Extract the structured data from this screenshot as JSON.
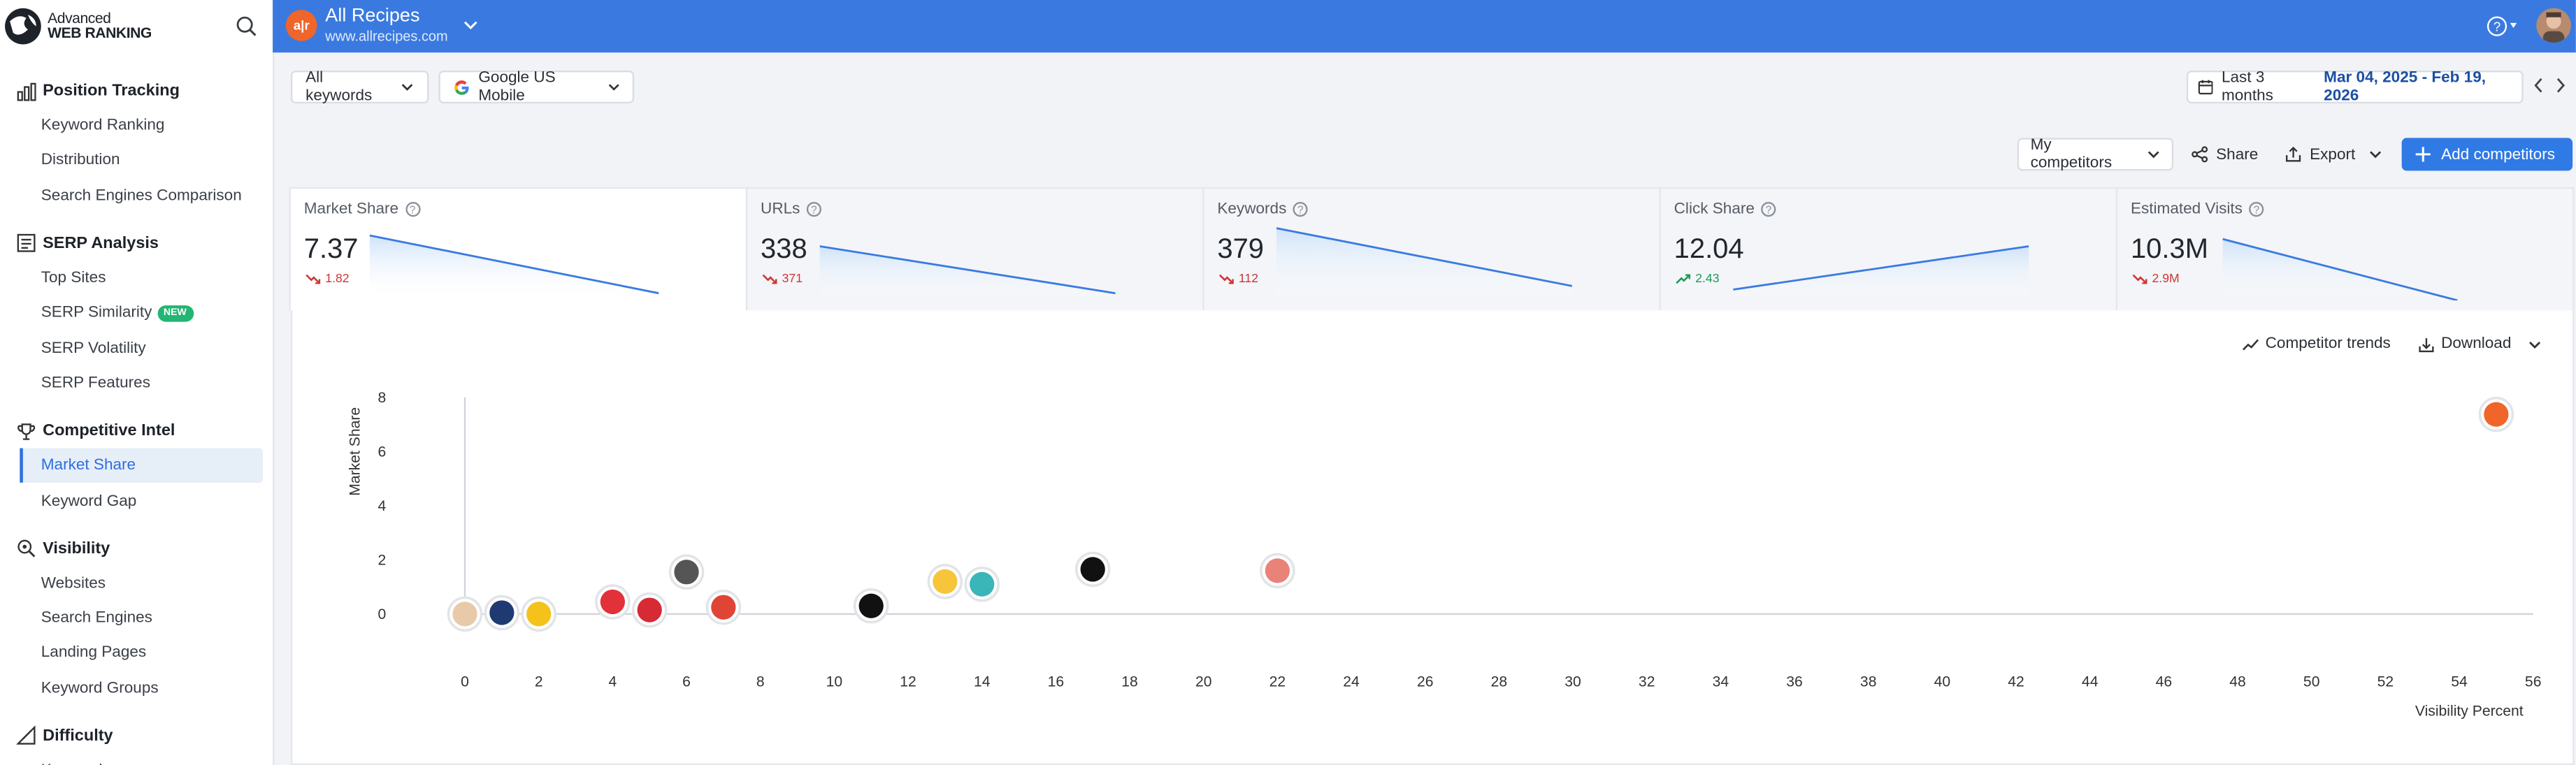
{
  "app": {
    "logo_line1": "Advanced",
    "logo_line2": "WEB RANKING"
  },
  "sidebar": {
    "sections": [
      {
        "label": "Position Tracking",
        "icon": "bar-chart-icon",
        "items": [
          {
            "label": "Keyword Ranking"
          },
          {
            "label": "Distribution"
          },
          {
            "label": "Search Engines Comparison"
          }
        ]
      },
      {
        "label": "SERP Analysis",
        "icon": "serp-icon",
        "items": [
          {
            "label": "Top Sites"
          },
          {
            "label": "SERP Similarity",
            "badge": "NEW"
          },
          {
            "label": "SERP Volatility"
          },
          {
            "label": "SERP Features"
          }
        ]
      },
      {
        "label": "Competitive Intel",
        "icon": "trophy-icon",
        "items": [
          {
            "label": "Market Share",
            "active": true
          },
          {
            "label": "Keyword Gap"
          }
        ]
      },
      {
        "label": "Visibility",
        "icon": "visibility-search-icon",
        "items": [
          {
            "label": "Websites"
          },
          {
            "label": "Search Engines"
          },
          {
            "label": "Landing Pages"
          },
          {
            "label": "Keyword Groups"
          }
        ]
      },
      {
        "label": "Difficulty",
        "icon": "difficulty-icon",
        "items": [
          {
            "label": "Keywords"
          }
        ]
      }
    ]
  },
  "header": {
    "project_name": "All Recipes",
    "project_url": "www.allrecipes.com",
    "project_logo_text": "a|r",
    "help_label": "?"
  },
  "filters": {
    "keywords": "All keywords",
    "engine": "Google US Mobile",
    "period_label": "Last 3 months",
    "date_range": "Mar 04, 2025 - Feb 19, 2026"
  },
  "toolbar": {
    "competitors": "My competitors",
    "share": "Share",
    "export": "Export",
    "add_competitors": "Add competitors"
  },
  "metrics": [
    {
      "label": "Market Share",
      "value": "7.37",
      "delta": "1.82",
      "trend": "down",
      "spark": [
        0.9,
        0.1
      ]
    },
    {
      "label": "URLs",
      "value": "338",
      "delta": "371",
      "trend": "down",
      "spark": [
        0.75,
        0.1
      ]
    },
    {
      "label": "Keywords",
      "value": "379",
      "delta": "112",
      "trend": "down",
      "spark": [
        1.0,
        0.2
      ]
    },
    {
      "label": "Click Share",
      "value": "12.04",
      "delta": "2.43",
      "trend": "up",
      "spark": [
        0.15,
        0.75
      ]
    },
    {
      "label": "Estimated Visits",
      "value": "10.3M",
      "delta": "2.9M",
      "trend": "down",
      "spark": [
        0.85,
        0.0
      ]
    }
  ],
  "chart_actions": {
    "trends": "Competitor trends",
    "download": "Download"
  },
  "chart_data": {
    "type": "scatter",
    "ylabel": "Market Share",
    "xlabel": "Visibility Percent",
    "ylim": [
      0,
      8
    ],
    "y_ticks": [
      "0",
      "2",
      "4",
      "6",
      "8"
    ],
    "x_ticks": [
      "0",
      "2",
      "4",
      "6",
      "8",
      "10",
      "12",
      "14",
      "16",
      "18",
      "20",
      "22",
      "24",
      "26",
      "28",
      "30",
      "32",
      "34",
      "36",
      "38",
      "40",
      "42",
      "44",
      "46",
      "48",
      "50",
      "52",
      "54",
      "56"
    ],
    "grid": false,
    "points": [
      {
        "x": 0.0,
        "y": 0.0,
        "icon": "person-photo-icon",
        "color": "#e8c9a8"
      },
      {
        "x": 1.0,
        "y": 0.05,
        "icon": "letter-p-icon",
        "color": "#1f3a73"
      },
      {
        "x": 2.0,
        "y": 0.0,
        "icon": "asterisk-icon",
        "color": "#f4c21b"
      },
      {
        "x": 4.0,
        "y": 0.45,
        "icon": "red-whisk-icon",
        "color": "#e23138"
      },
      {
        "x": 5.0,
        "y": 0.15,
        "icon": "red-square-icon",
        "color": "#d62a34"
      },
      {
        "x": 6.0,
        "y": 1.55,
        "icon": "swirl-heart-icon",
        "color": "#555555"
      },
      {
        "x": 7.0,
        "y": 0.25,
        "icon": "red-badge-icon",
        "color": "#e04436"
      },
      {
        "x": 11.0,
        "y": 0.3,
        "icon": "letter-f-icon",
        "color": "#111111"
      },
      {
        "x": 13.0,
        "y": 1.2,
        "icon": "yellow-hat-icon",
        "color": "#f6c53a"
      },
      {
        "x": 14.0,
        "y": 1.1,
        "icon": "teal-flower-icon",
        "color": "#3ab5b8"
      },
      {
        "x": 17.0,
        "y": 1.65,
        "icon": "bear-icon",
        "color": "#111111"
      },
      {
        "x": 22.0,
        "y": 1.6,
        "icon": "striped-s-icon",
        "color": "#e9837a"
      },
      {
        "x": 55.0,
        "y": 7.37,
        "icon": "allrecipes-logo-icon",
        "color": "#f0652a"
      }
    ]
  }
}
